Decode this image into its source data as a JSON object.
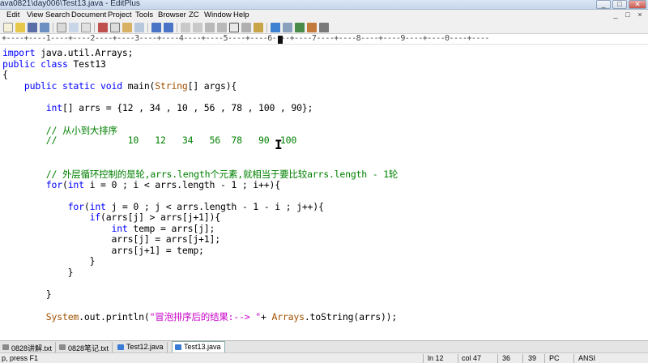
{
  "window": {
    "title": "ava0821\\day006\\Test13.java - EditPlus",
    "buttons": [
      "_",
      "□",
      "✕"
    ]
  },
  "menu": {
    "items": [
      "Edit",
      "View",
      "Search",
      "Document",
      "Project",
      "Tools",
      "Browser",
      "ZC",
      "Window",
      "Help"
    ],
    "mdi_controls": [
      "_",
      "□",
      "×"
    ]
  },
  "ruler": {
    "text": "+----+----1----+----2----+----3----+----4----+----5----+----6----+----7----+----8----+----9----+----0----+----"
  },
  "editor": {
    "lines": [
      {
        "parts": [
          {
            "t": "import",
            "c": "kw"
          },
          {
            "t": " java.util.Arrays;",
            "c": ""
          }
        ]
      },
      {
        "parts": [
          {
            "t": "public class",
            "c": "kw"
          },
          {
            "t": " Test13",
            "c": ""
          }
        ]
      },
      {
        "parts": [
          {
            "t": "{",
            "c": ""
          }
        ]
      },
      {
        "parts": [
          {
            "t": "    ",
            "c": ""
          },
          {
            "t": "public static void",
            "c": "kw"
          },
          {
            "t": " main(",
            "c": ""
          },
          {
            "t": "String",
            "c": "cls"
          },
          {
            "t": "[] args){",
            "c": ""
          }
        ]
      },
      {
        "parts": [
          {
            "t": "",
            "c": ""
          }
        ]
      },
      {
        "parts": [
          {
            "t": "        ",
            "c": ""
          },
          {
            "t": "int",
            "c": "kw"
          },
          {
            "t": "[] arrs = {12 , 34 , 10 , 56 , 78 , 100 , 90};",
            "c": ""
          }
        ]
      },
      {
        "parts": [
          {
            "t": "",
            "c": ""
          }
        ]
      },
      {
        "parts": [
          {
            "t": "        ",
            "c": ""
          },
          {
            "t": "// 从小到大排序",
            "c": "cm"
          }
        ]
      },
      {
        "parts": [
          {
            "t": "        ",
            "c": ""
          },
          {
            "t": "//             10   12   34   56  78   90  100",
            "c": "cm"
          }
        ]
      },
      {
        "parts": [
          {
            "t": "",
            "c": ""
          }
        ]
      },
      {
        "parts": [
          {
            "t": "",
            "c": ""
          }
        ]
      },
      {
        "parts": [
          {
            "t": "        ",
            "c": ""
          },
          {
            "t": "// 外层循环控制的是轮,arrs.length个元素,就相当于要比较arrs.length - 1轮",
            "c": "cm"
          }
        ]
      },
      {
        "parts": [
          {
            "t": "        ",
            "c": ""
          },
          {
            "t": "for",
            "c": "kw"
          },
          {
            "t": "(",
            "c": ""
          },
          {
            "t": "int",
            "c": "kw"
          },
          {
            "t": " i = 0 ; i < arrs.length - 1 ; i++){",
            "c": ""
          }
        ]
      },
      {
        "parts": [
          {
            "t": "",
            "c": ""
          }
        ]
      },
      {
        "parts": [
          {
            "t": "            ",
            "c": ""
          },
          {
            "t": "for",
            "c": "kw"
          },
          {
            "t": "(",
            "c": ""
          },
          {
            "t": "int",
            "c": "kw"
          },
          {
            "t": " j = 0 ; j < arrs.length - 1 - i ; j++){",
            "c": ""
          }
        ]
      },
      {
        "parts": [
          {
            "t": "                ",
            "c": ""
          },
          {
            "t": "if",
            "c": "kw"
          },
          {
            "t": "(arrs[j] > arrs[j+1]){",
            "c": ""
          }
        ]
      },
      {
        "parts": [
          {
            "t": "                    ",
            "c": ""
          },
          {
            "t": "int",
            "c": "kw"
          },
          {
            "t": " temp = arrs[j];",
            "c": ""
          }
        ]
      },
      {
        "parts": [
          {
            "t": "                    arrs[j] = arrs[j+1];",
            "c": ""
          }
        ]
      },
      {
        "parts": [
          {
            "t": "                    arrs[j+1] = temp;",
            "c": ""
          }
        ]
      },
      {
        "parts": [
          {
            "t": "                }",
            "c": ""
          }
        ]
      },
      {
        "parts": [
          {
            "t": "            }",
            "c": ""
          }
        ]
      },
      {
        "parts": [
          {
            "t": "",
            "c": ""
          }
        ]
      },
      {
        "parts": [
          {
            "t": "        }",
            "c": ""
          }
        ]
      },
      {
        "parts": [
          {
            "t": "",
            "c": ""
          }
        ]
      },
      {
        "parts": [
          {
            "t": "        ",
            "c": ""
          },
          {
            "t": "System",
            "c": "cls"
          },
          {
            "t": ".out.println(",
            "c": ""
          },
          {
            "t": "\"冒泡排序后的结果:--> \"",
            "c": "str"
          },
          {
            "t": "+ ",
            "c": ""
          },
          {
            "t": "Arrays",
            "c": "cls"
          },
          {
            "t": ".toString(arrs));",
            "c": ""
          }
        ]
      }
    ]
  },
  "tabs": [
    {
      "label": "0828讲解.txt",
      "color": "#8a8a8a",
      "active": false
    },
    {
      "label": "0828笔记.txt",
      "color": "#8a8a8a",
      "active": false
    },
    {
      "label": "Test12.java",
      "color": "#3a7bd5",
      "active": false
    },
    {
      "label": "Test13.java",
      "color": "#3a7bd5",
      "active": true
    }
  ],
  "status": {
    "help_text": "p, press F1",
    "line": "ln 12",
    "col": "col 47",
    "v1": "36",
    "v2": "39",
    "mode": "PC",
    "encoding": "ANSI"
  },
  "colors": {
    "keyword": "#0000ff",
    "comment": "#008000",
    "string": "#c800c8",
    "class": "#a05000"
  }
}
